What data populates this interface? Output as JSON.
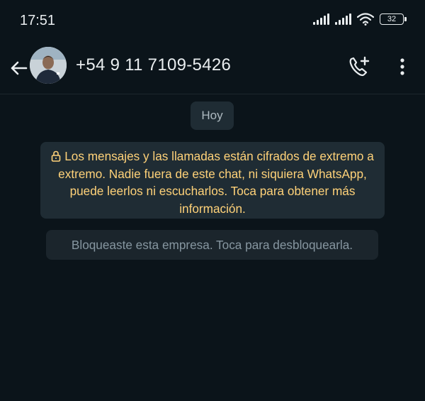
{
  "status_bar": {
    "time": "17:51",
    "battery_level": "32"
  },
  "header": {
    "contact_name": "+54 9 11 7109-5426",
    "icons": [
      "back-arrow-icon",
      "avatar",
      "add-call-icon",
      "more-options-icon"
    ]
  },
  "chat": {
    "date_label": "Hoy",
    "encryption_notice": "Los mensajes y las llamadas están cifrados de extremo a extremo. Nadie fuera de este chat, ni siquiera WhatsApp, puede leerlos ni escucharlos. Toca para obtener más información.",
    "blocked_notice": "Bloqueaste esta empresa. Toca para desbloquearla."
  },
  "colors": {
    "background": "#0b141a",
    "bubble": "#1f2c34",
    "notice_text": "#ffd279",
    "muted_text": "#8696a0"
  }
}
